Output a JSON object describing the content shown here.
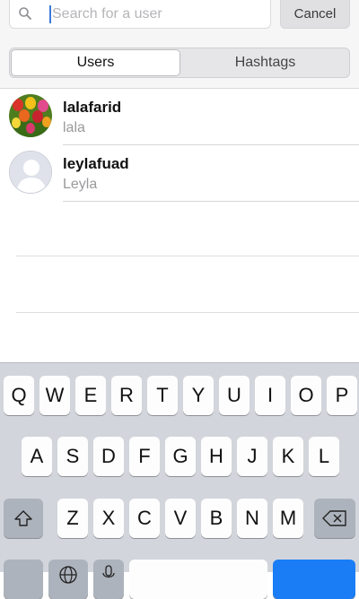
{
  "search": {
    "placeholder": "Search for a user",
    "value": ""
  },
  "cancel_label": "Cancel",
  "tabs": [
    {
      "label": "Users",
      "active": true
    },
    {
      "label": "Hashtags",
      "active": false
    }
  ],
  "results": [
    {
      "username": "lalafarid",
      "full_name": "lala"
    },
    {
      "username": "leylafuad",
      "full_name": "Leyla"
    }
  ],
  "keyboard": {
    "row1": [
      "Q",
      "W",
      "E",
      "R",
      "T",
      "Y",
      "U",
      "I",
      "O",
      "P"
    ],
    "row2": [
      "A",
      "S",
      "D",
      "F",
      "G",
      "H",
      "J",
      "K",
      "L"
    ],
    "row3": [
      "Z",
      "X",
      "C",
      "V",
      "B",
      "N",
      "M"
    ],
    "shift_icon": "shift-icon",
    "delete_icon": "backspace-icon"
  }
}
